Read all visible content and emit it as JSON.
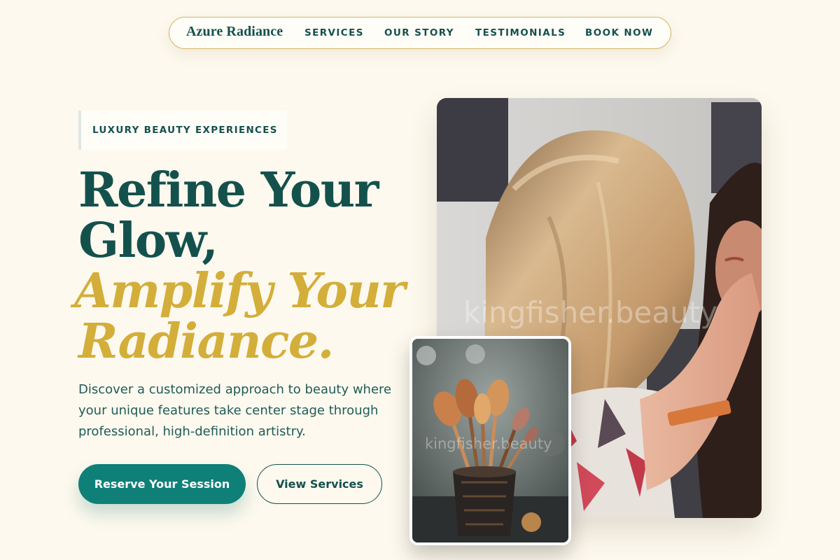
{
  "nav": {
    "brand": "Azure Radiance",
    "links": [
      "SERVICES",
      "OUR STORY",
      "TESTIMONIALS",
      "BOOK NOW"
    ]
  },
  "hero": {
    "eyebrow": "LUXURY BEAUTY EXPERIENCES",
    "headline": {
      "line1": "Refine Your",
      "line2": "Glow,",
      "line3": "Amplify Your",
      "line4": "Radiance."
    },
    "description": "Discover a customized approach to beauty where your unique features take center stage through professional, high-definition artistry.",
    "primary_cta": "Reserve Your Session",
    "secondary_cta": "View Services"
  },
  "images": {
    "main_photo": "makeup-artist-applying-makeup-photo",
    "small_photo": "makeup-brushes-in-cup-photo",
    "watermark": "kingfisher.beauty"
  },
  "colors": {
    "background": "#fdf9ee",
    "primary": "#14514d",
    "teal_button": "#0e8078",
    "gold_accent": "#d3ae3a",
    "nav_border": "#d4b765"
  }
}
